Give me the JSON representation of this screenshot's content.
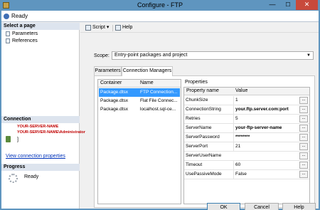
{
  "window": {
    "title": "Configure - FTP"
  },
  "status": {
    "text": "Ready"
  },
  "left": {
    "select_page_title": "Select a page",
    "pages": [
      "Parameters",
      "References"
    ],
    "connection_title": "Connection",
    "connection_lines": [
      "YOUR-SERVER-NAME",
      "YOUR-SERVER-NAME\\Administrator"
    ],
    "connection_bracket": "]",
    "view_link": "View connection properties",
    "progress_title": "Progress",
    "progress_text": "Ready"
  },
  "toolbar": {
    "script_label": "Script",
    "script_dropdown": "▾",
    "help_label": "Help"
  },
  "scope": {
    "label": "Scope:",
    "value": "Entry-point packages and project"
  },
  "tabs": [
    "Parameters",
    "Connection Managers"
  ],
  "containers": {
    "headers": [
      "Container",
      "Name"
    ],
    "rows": [
      [
        "Package.dtsx",
        "FTP Connection..."
      ],
      [
        "Package.dtsx",
        "Flat File Connec..."
      ],
      [
        "Package.dtsx",
        "localhost.sql-ce..."
      ]
    ]
  },
  "properties": {
    "label": "Properties",
    "headers": [
      "Property name",
      "Value"
    ],
    "rows": [
      {
        "name": "ChunkSize",
        "value": "1",
        "bold": false
      },
      {
        "name": "ConnectionString",
        "value": "your.ftp.server.com:port",
        "bold": true
      },
      {
        "name": "Retries",
        "value": "5",
        "bold": false
      },
      {
        "name": "ServerName",
        "value": "your-ftp-server-name",
        "bold": true
      },
      {
        "name": "ServerPassword",
        "value": "********",
        "bold": true
      },
      {
        "name": "ServerPort",
        "value": "21",
        "bold": false
      },
      {
        "name": "ServerUserName",
        "value": "",
        "bold": false
      },
      {
        "name": "Timeout",
        "value": "60",
        "bold": false
      },
      {
        "name": "UsePassiveMode",
        "value": "False",
        "bold": false
      }
    ],
    "ellipsis": "..."
  },
  "buttons": {
    "ok": "OK",
    "cancel": "Cancel",
    "help": "Help"
  },
  "colors": {
    "accent": "#5f95bf",
    "selection": "#3399ff",
    "connection_text": "#c00000",
    "link": "#0033bb"
  }
}
